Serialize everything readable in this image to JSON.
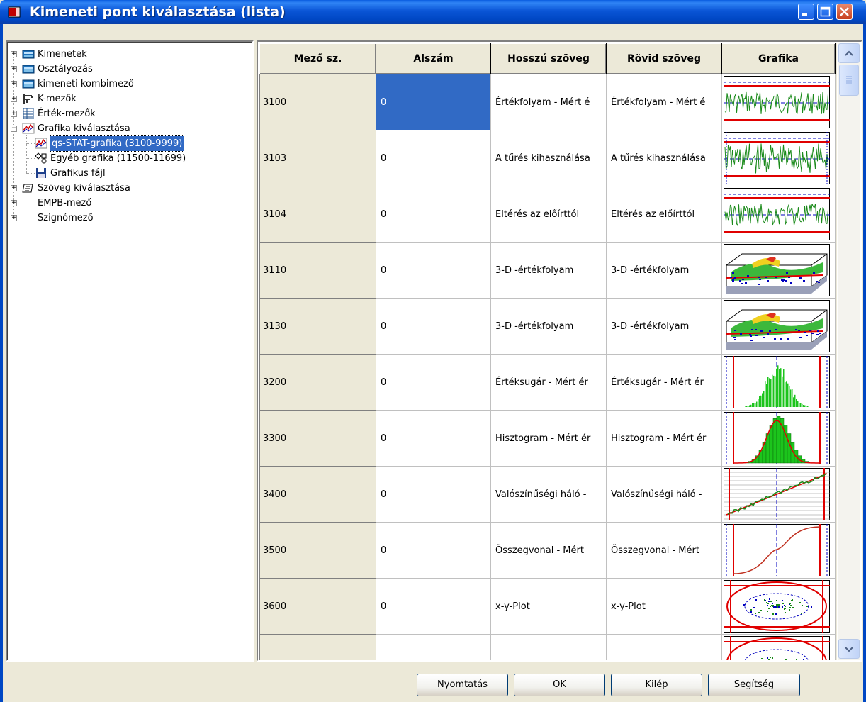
{
  "window": {
    "title": "Kimeneti pont kiválasztása (lista)",
    "controls": {
      "minimize_icon": "minimize-icon",
      "maximize_icon": "maximize-icon",
      "close_icon": "close-icon"
    }
  },
  "tree": {
    "items": [
      {
        "label": "Kimenetek",
        "icon": "calculator-icon",
        "expander": "+"
      },
      {
        "label": "Osztályozás",
        "icon": "calculator-icon",
        "expander": "+"
      },
      {
        "label": "kimeneti kombimező",
        "icon": "calculator-icon",
        "expander": "+"
      },
      {
        "label": "K-mezők",
        "icon": "caliper-icon",
        "expander": "+"
      },
      {
        "label": "Érték-mezők",
        "icon": "table-icon",
        "expander": "+"
      },
      {
        "label": "Grafika kiválasztása",
        "icon": "chart-icon",
        "expander": "−"
      },
      {
        "label": "qs-STAT-grafika (3100-9999)",
        "icon": "chart-icon",
        "selected": true
      },
      {
        "label": "Egyéb grafika (11500-11699)",
        "icon": "shapes-icon"
      },
      {
        "label": "Grafikus fájl",
        "icon": "floppy-icon"
      },
      {
        "label": "Szöveg kiválasztása",
        "icon": "text-icon",
        "expander": "+"
      },
      {
        "label": "EMPB-mező",
        "icon": "",
        "expander": "+"
      },
      {
        "label": "Szignómező",
        "icon": "",
        "expander": "+"
      }
    ]
  },
  "grid": {
    "columns": [
      "Mező sz.",
      "Alszám",
      "Hosszú szöveg",
      "Rövid szöveg",
      "Grafika"
    ],
    "rows": [
      {
        "mezo": "3100",
        "alszam": "0",
        "hosszu": "Értékfolyam - Mért é",
        "rovid": "Értékfolyam - Mért é",
        "graphic": "value-course-thumbnail"
      },
      {
        "mezo": "3103",
        "alszam": "0",
        "hosszu": "A tűrés kihasználása",
        "rovid": "A tűrés kihasználása",
        "graphic": "tolerance-use-thumbnail"
      },
      {
        "mezo": "3104",
        "alszam": "0",
        "hosszu": "Eltérés az előírttól",
        "rovid": "Eltérés az előírttól",
        "graphic": "deviation-thumbnail"
      },
      {
        "mezo": "3110",
        "alszam": "0",
        "hosszu": "3-D -értékfolyam",
        "rovid": "3-D -értékfolyam",
        "graphic": "3d-course-thumbnail"
      },
      {
        "mezo": "3130",
        "alszam": "0",
        "hosszu": "3-D -értékfolyam",
        "rovid": "3-D -értékfolyam",
        "graphic": "3d-course-thumbnail"
      },
      {
        "mezo": "3200",
        "alszam": "0",
        "hosszu": "Értéksugár - Mért ér",
        "rovid": "Értéksugár - Mért ér",
        "graphic": "value-ray-thumbnail"
      },
      {
        "mezo": "3300",
        "alszam": "0",
        "hosszu": "Hisztogram - Mért ér",
        "rovid": "Hisztogram - Mért ér",
        "graphic": "histogram-thumbnail"
      },
      {
        "mezo": "3400",
        "alszam": "0",
        "hosszu": "Valószínűségi háló -",
        "rovid": "Valószínűségi háló -",
        "graphic": "probability-net-thumbnail"
      },
      {
        "mezo": "3500",
        "alszam": "0",
        "hosszu": "Összegvonal - Mért",
        "rovid": "Összegvonal - Mért",
        "graphic": "sum-line-thumbnail"
      },
      {
        "mezo": "3600",
        "alszam": "0",
        "hosszu": "x-y-Plot",
        "rovid": "x-y-Plot",
        "graphic": "xy-plot-thumbnail"
      },
      {
        "mezo": "",
        "alszam": "",
        "hosszu": "",
        "rovid": "",
        "graphic": "xy-plot-thumbnail"
      }
    ]
  },
  "buttons": {
    "print": "Nyomtatás",
    "ok": "OK",
    "exit": "Kilép",
    "help": "Segítség"
  },
  "colors": {
    "selection": "#316ac5",
    "titlebar": "#0047c4",
    "chart_green": "#1a8a1a",
    "chart_red": "#e00000"
  }
}
